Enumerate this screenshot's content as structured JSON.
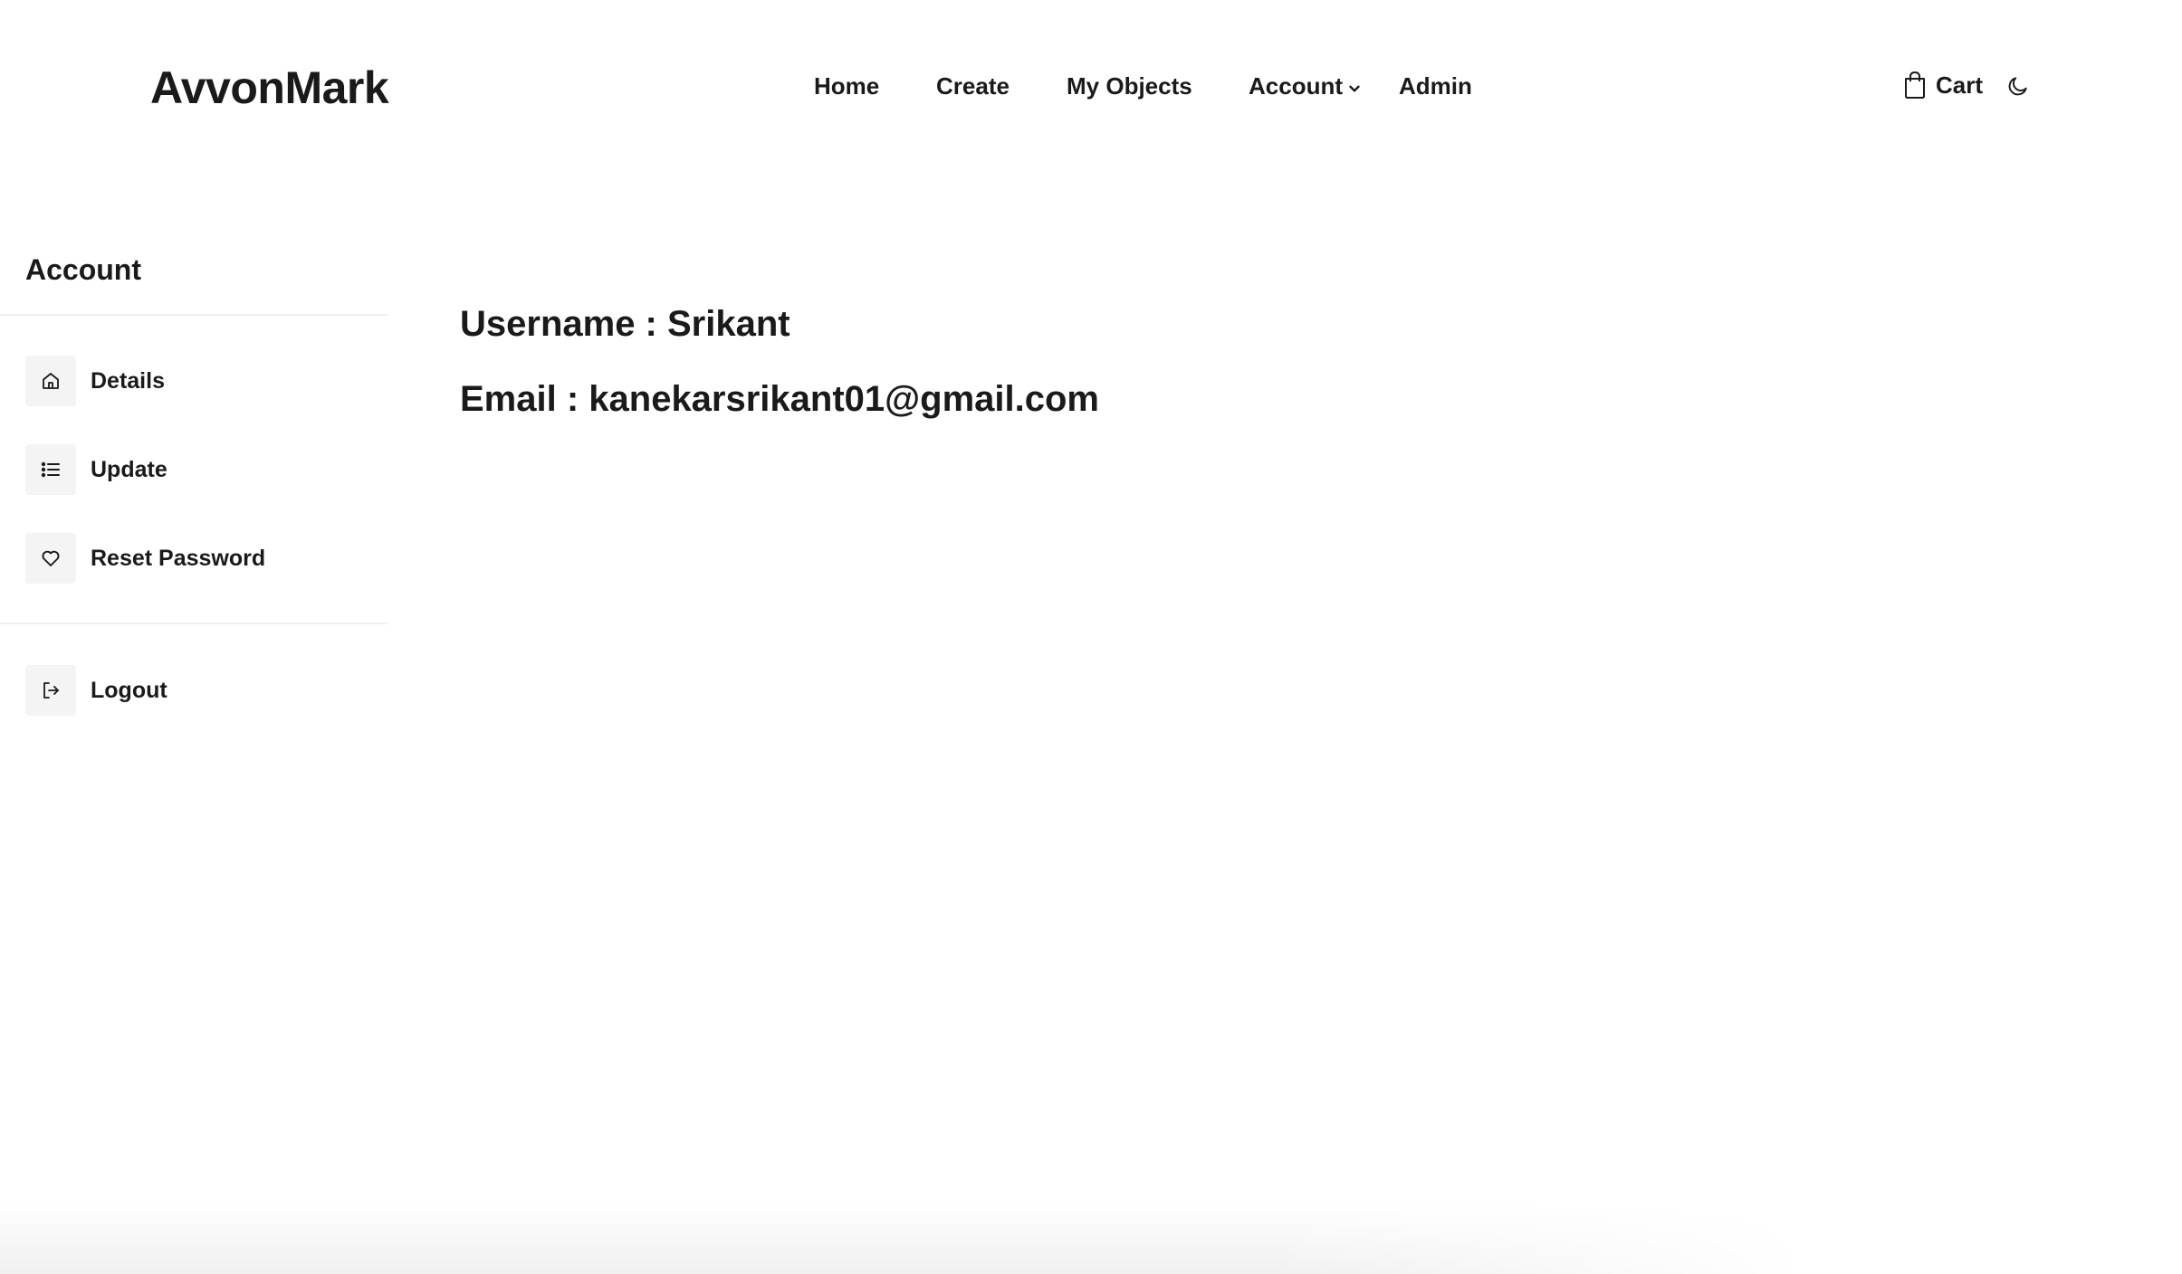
{
  "header": {
    "brand": "AvvonMark",
    "nav": {
      "home": "Home",
      "create": "Create",
      "my_objects": "My Objects",
      "account": "Account",
      "admin": "Admin"
    },
    "cart_label": "Cart",
    "icons": {
      "account_dropdown": "chevron-down-icon",
      "cart": "shopping-bag-icon",
      "theme": "moon-icon"
    }
  },
  "sidebar": {
    "title": "Account",
    "items": [
      {
        "label": "Details",
        "icon": "home-icon"
      },
      {
        "label": "Update",
        "icon": "list-icon"
      },
      {
        "label": "Reset Password",
        "icon": "heart-icon"
      },
      {
        "label": "Logout",
        "icon": "logout-icon"
      }
    ]
  },
  "main": {
    "username_line": "Username : Srikant",
    "email_line": "Email : kanekarsrikant01@gmail.com"
  },
  "colors": {
    "text": "#1a1a1a",
    "icon_box_bg": "#f4f4f4",
    "divider": "#efefef",
    "background": "#ffffff"
  }
}
